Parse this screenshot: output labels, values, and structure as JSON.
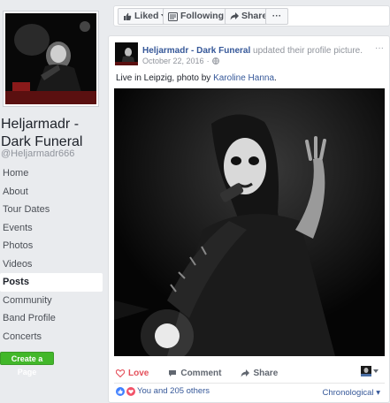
{
  "sidebar": {
    "page_name": "Heljarmadr - Dark Funeral",
    "handle": "@Heljarmadr666",
    "nav_items": [
      "Home",
      "About",
      "Tour Dates",
      "Events",
      "Photos",
      "Videos",
      "Posts",
      "Community",
      "Band Profile",
      "Concerts"
    ],
    "active_item": "Posts",
    "create_page_label": "Create a Page"
  },
  "topbar": {
    "liked_label": "Liked",
    "following_label": "Following",
    "share_label": "Share",
    "more_label": "···"
  },
  "post": {
    "author": "Heljarmadr - Dark Funeral",
    "action": "updated their profile picture.",
    "date": "October 22, 2016",
    "menu_label": "···",
    "text_prefix": "Live in Leipzig, photo by ",
    "text_link": "Karoline Hanna",
    "text_suffix": ".",
    "actions": {
      "love": "Love",
      "comment": "Comment",
      "share": "Share"
    },
    "reactions_text": "You and 205 others",
    "sort_label": "Chronological"
  },
  "colors": {
    "link": "#365899",
    "love": "#e4505b",
    "create_button": "#42b72a",
    "background": "#e9ebee"
  }
}
